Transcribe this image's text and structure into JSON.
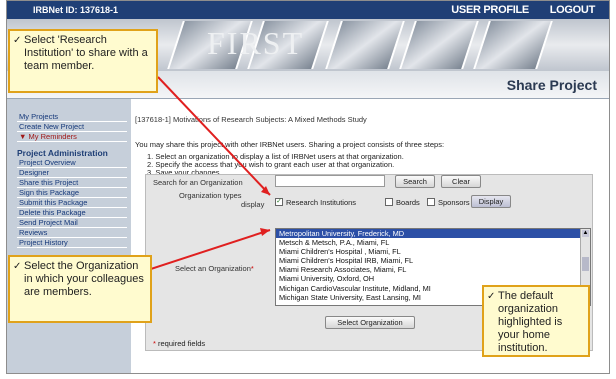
{
  "header": {
    "irbnet_id": "IRBNet ID: 137618-1",
    "user_profile": "USER PROFILE",
    "logout": "LOGOUT"
  },
  "banner": {
    "text": "FIRST"
  },
  "page_title": "Share Project",
  "sidebar": {
    "top_items": [
      "My Projects",
      "Create New Project",
      "My Reminders"
    ],
    "section_title": "Project Administration",
    "admin_items": [
      "Project Overview",
      "Designer",
      "Share this Project",
      "Sign this Package",
      "Submit this Package",
      "Delete this Package",
      "Send Project Mail",
      "Reviews",
      "Project History"
    ]
  },
  "project_title": "[137618-1] Motivations of Research Subjects: A Mixed Methods Study",
  "intro_text": "You may share this project with other IRBNet users. Sharing a project consists of three steps:",
  "steps": [
    "1.  Select an organization to display a list of IRBNet users at that organization.",
    "2.  Specify the access that you wish to grant each user at that organization.",
    "3.  Save your changes."
  ],
  "form": {
    "search_label": "Search for an Organization",
    "search_value": "",
    "search_button": "Search",
    "clear_button": "Clear",
    "org_types_label_1": "Organization types",
    "org_types_label_2": "display",
    "types": [
      "Research Institutions",
      "Boards",
      "Sponsors"
    ],
    "types_checked": [
      true,
      false,
      false
    ],
    "display_button": "Display",
    "select_label": "Select an Organization",
    "required_star": "*",
    "organizations": [
      "Metropolitan University, Frederick, MD",
      "Metsch & Metsch, P.A., Miami, FL",
      "Miami Children's Hospital , Miami, FL",
      "Miami Children's Hospital IRB, Miami, FL",
      "Miami Research Associates, Miami, FL",
      "Miami University, Oxford, OH",
      "Michigan CardioVascular Institute, Midland, MI",
      "Michigan State University, East Lansing, MI"
    ],
    "selected_index": 0,
    "select_button": "Select Organization",
    "required_note": "required fields"
  },
  "callouts": {
    "research": "Select 'Research Institution' to share with a team member.",
    "organization": "Select the Organization in which your colleagues are members.",
    "default": "The default organization highlighted is your home institution.",
    "check": "✓"
  },
  "colors": {
    "header_bg": "#1f3f76",
    "selected_bg": "#2c4fa6",
    "callout_bg": "#fffbcf",
    "callout_border": "#e0a21a",
    "arrow": "#e02020"
  }
}
